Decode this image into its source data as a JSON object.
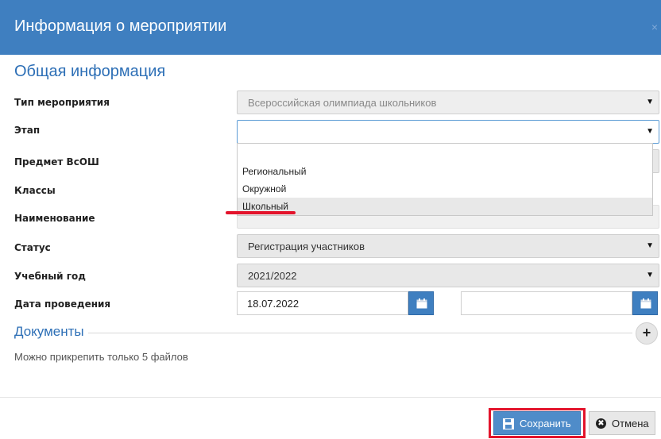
{
  "dialog": {
    "title": "Информация о мероприятии",
    "close": "×"
  },
  "general": {
    "section_title": "Общая информация",
    "fields": {
      "type": {
        "label": "Тип мероприятия",
        "value": "Всероссийская олимпиада школьников"
      },
      "stage": {
        "label": "Этап",
        "value": ""
      },
      "subject": {
        "label": "Предмет ВсОШ"
      },
      "classes": {
        "label": "Классы"
      },
      "name": {
        "label": "Наименование"
      },
      "status": {
        "label": "Статус",
        "value": "Регистрация участников"
      },
      "year": {
        "label": "Учебный год",
        "value": "2021/2022"
      },
      "date": {
        "label": "Дата проведения",
        "from": "18.07.2022",
        "to": ""
      }
    }
  },
  "stage_dropdown": {
    "options": [
      "",
      "Региональный",
      "Окружной",
      "Школьный"
    ],
    "highlighted": "Школьный"
  },
  "documents": {
    "section_title": "Документы",
    "hint": "Можно прикрепить только 5 файлов",
    "add": "+"
  },
  "footer": {
    "save_label": "Сохранить",
    "cancel_label": "Отмена"
  },
  "icons": [
    "close-icon",
    "chevron-down-icon",
    "calendar-icon",
    "plus-icon",
    "save-icon",
    "cancel-icon"
  ],
  "colors": {
    "header": "#3f7fc0",
    "accent": "#2d6fb6",
    "highlight": "#e3132b"
  }
}
